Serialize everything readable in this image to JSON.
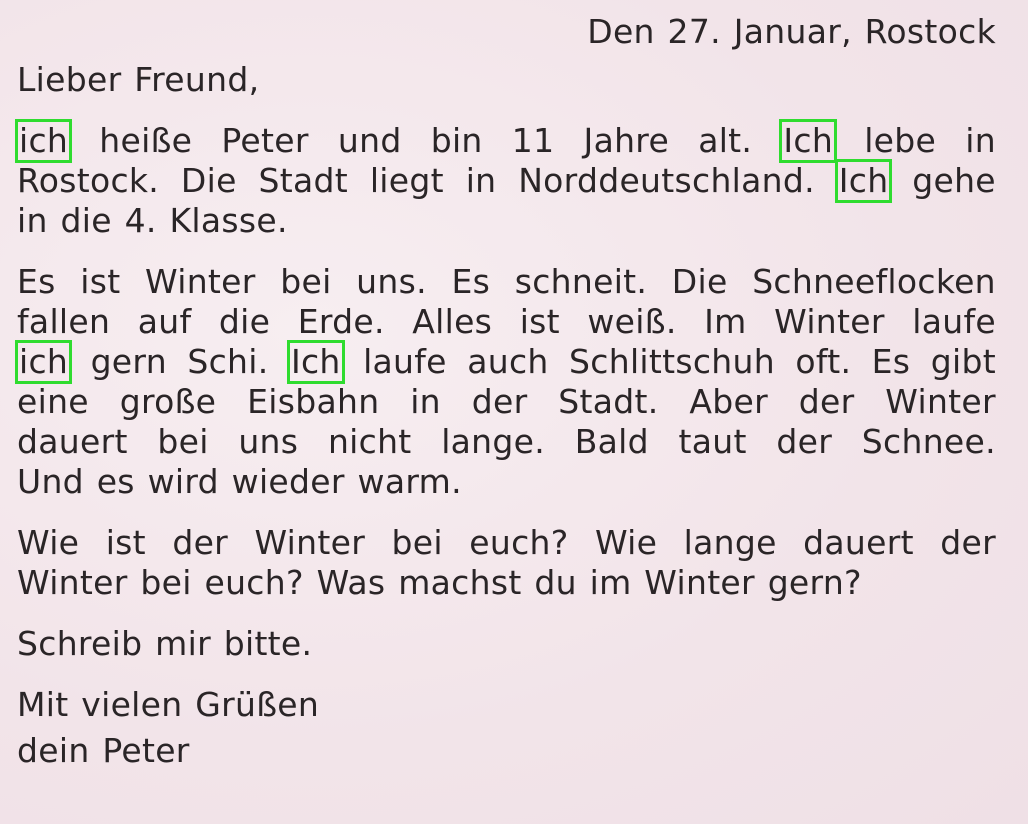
{
  "letter": {
    "date": "Den 27. Januar, Rostock",
    "salutation": "Lieber Freund,",
    "p1": {
      "l1": [
        "ich",
        "heiße",
        "Peter",
        "und",
        "bin",
        "11",
        "Jahre",
        "alt.",
        "Ich",
        "lebe",
        "in"
      ],
      "l2": [
        "Rostock.",
        "Die",
        "Stadt",
        "liegt",
        "in",
        "Norddeutschland.",
        "Ich",
        "gehe"
      ],
      "l3": "in die 4. Klasse."
    },
    "p2": {
      "l1": [
        "Es",
        "ist",
        "Winter",
        "bei",
        "uns.",
        "Es",
        "schneit.",
        "Die",
        "Schneeflocken"
      ],
      "l2": [
        "fallen",
        "auf",
        "die",
        "Erde.",
        "Alles",
        "ist",
        "weiß.",
        "Im",
        "Winter",
        "laufe"
      ],
      "l3": [
        "ich",
        "gern",
        "Schi.",
        "Ich",
        "laufe",
        "auch",
        "Schlittschuh",
        "oft.",
        "Es",
        "gibt"
      ],
      "l4": [
        "eine",
        "große",
        "Eisbahn",
        "in",
        "der",
        "Stadt.",
        "Aber",
        "der",
        "Winter"
      ],
      "l5": [
        "dauert",
        "bei",
        "uns",
        "nicht",
        "lange.",
        "Bald",
        "taut",
        "der",
        "Schnee."
      ],
      "l6": "Und es wird wieder warm."
    },
    "p3": {
      "l1": [
        "Wie",
        "ist",
        "der",
        "Winter",
        "bei",
        "euch?",
        "Wie",
        "lange",
        "dauert",
        "der"
      ],
      "l2": "Winter bei euch? Was machst du im Winter gern?"
    },
    "request": "Schreib mir bitte.",
    "closing": "Mit vielen Grüßen",
    "signature": "dein Peter"
  },
  "highlight_color": "#2fdc2f"
}
